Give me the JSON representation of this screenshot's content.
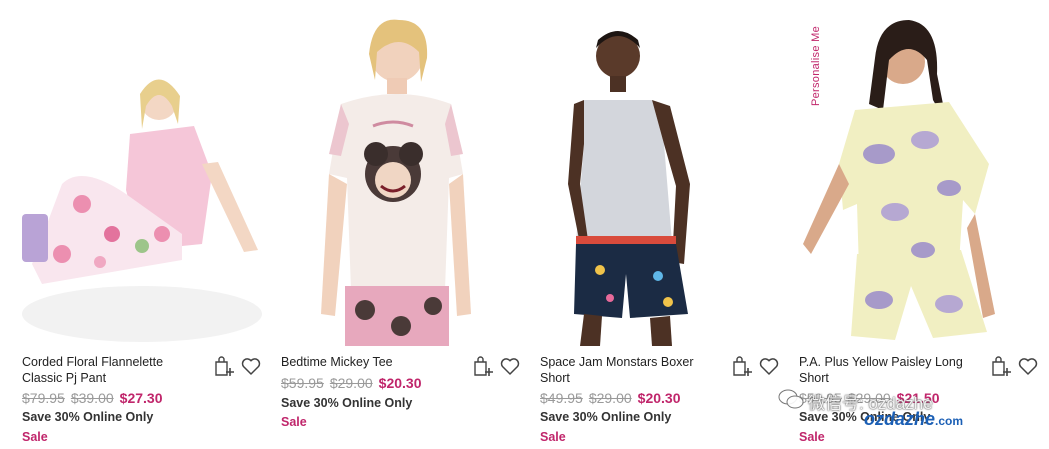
{
  "products": [
    {
      "title": "Corded Floral Flannelette Classic Pj Pant",
      "prices": [
        "$79.95",
        "$39.00",
        "$27.30"
      ],
      "promo": "Save 30% Online Only",
      "badge": "Sale",
      "image_alt": "Model in pink tee and floral flannelette pj pants"
    },
    {
      "title": "Bedtime Mickey Tee",
      "prices": [
        "$59.95",
        "$29.00",
        "$20.30"
      ],
      "promo": "Save 30% Online Only",
      "badge": "Sale",
      "image_alt": "Model in white Mickey tee"
    },
    {
      "title": "Space Jam Monstars Boxer Short",
      "prices": [
        "$49.95",
        "$29.00",
        "$20.30"
      ],
      "promo": "Save 30% Online Only",
      "badge": "Sale",
      "image_alt": "Model in grey tank and navy boxer shorts"
    },
    {
      "title": "P.A. Plus Yellow Paisley Long Short",
      "prices": [
        "$59.95",
        "$29.00",
        "$21.50"
      ],
      "promo": "Save 30% Online Only",
      "badge": "Sale",
      "image_alt": "Model in yellow paisley pj set"
    }
  ],
  "personalise_label": "Personalise Me",
  "watermark": {
    "line1": "微信号: ozdazhe",
    "logo": "ozdazhe",
    "logo_suffix": ".com"
  },
  "colors": {
    "sale_pink": "#c0266b",
    "strike_grey": "#9a9a9a"
  },
  "icons": [
    "add-to-bag-icon",
    "heart-icon"
  ]
}
